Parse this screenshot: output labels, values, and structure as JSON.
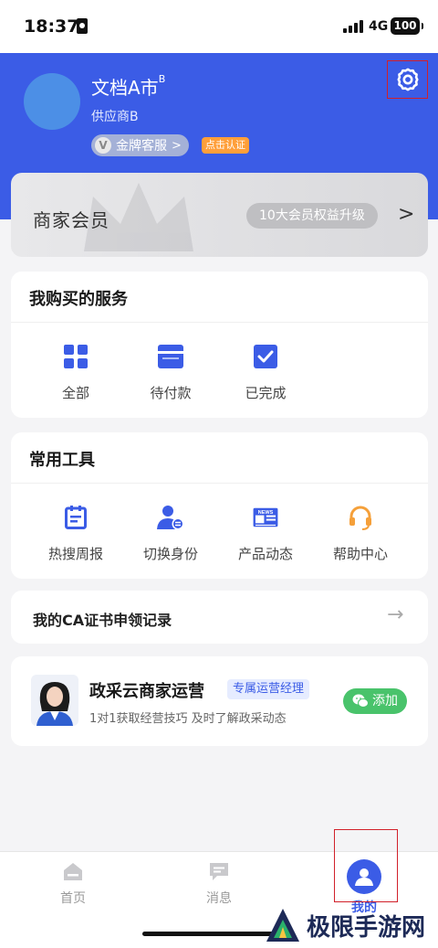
{
  "status_bar": {
    "time": "18:37",
    "network": "4G",
    "battery": "100"
  },
  "header": {
    "user_name": "文档A市",
    "user_name_sup": "B",
    "user_role": "供应商B",
    "vip_label": "金牌客服",
    "certify_label": "点击认证",
    "settings_icon": "gear-icon"
  },
  "member": {
    "title": "商家会员",
    "badge": "10大会员权益升级"
  },
  "services": {
    "title": "我购买的服务",
    "items": [
      {
        "label": "全部",
        "icon": "grid-icon"
      },
      {
        "label": "待付款",
        "icon": "wallet-icon"
      },
      {
        "label": "已完成",
        "icon": "check-icon"
      }
    ]
  },
  "tools": {
    "title": "常用工具",
    "items": [
      {
        "label": "热搜周报",
        "icon": "calendar-report-icon"
      },
      {
        "label": "切换身份",
        "icon": "switch-user-icon"
      },
      {
        "label": "产品动态",
        "icon": "news-icon",
        "icon_text": "NEWS"
      },
      {
        "label": "帮助中心",
        "icon": "headset-icon"
      }
    ]
  },
  "ca": {
    "title": "我的CA证书申领记录"
  },
  "ops": {
    "title": "政采云商家运营",
    "tag": "专属运营经理",
    "desc": "1对1获取经营技巧 及时了解政采动态",
    "add_label": "添加"
  },
  "tabs": [
    {
      "label": "首页",
      "icon": "home-icon"
    },
    {
      "label": "消息",
      "icon": "message-icon"
    },
    {
      "label": "我的",
      "icon": "user-icon"
    }
  ],
  "watermark": {
    "text": "极限手游网"
  },
  "colors": {
    "primary": "#3b5ce6",
    "accent_orange": "#ff9f3a",
    "green": "#49c36b",
    "highlight_box": "#d1202a"
  }
}
